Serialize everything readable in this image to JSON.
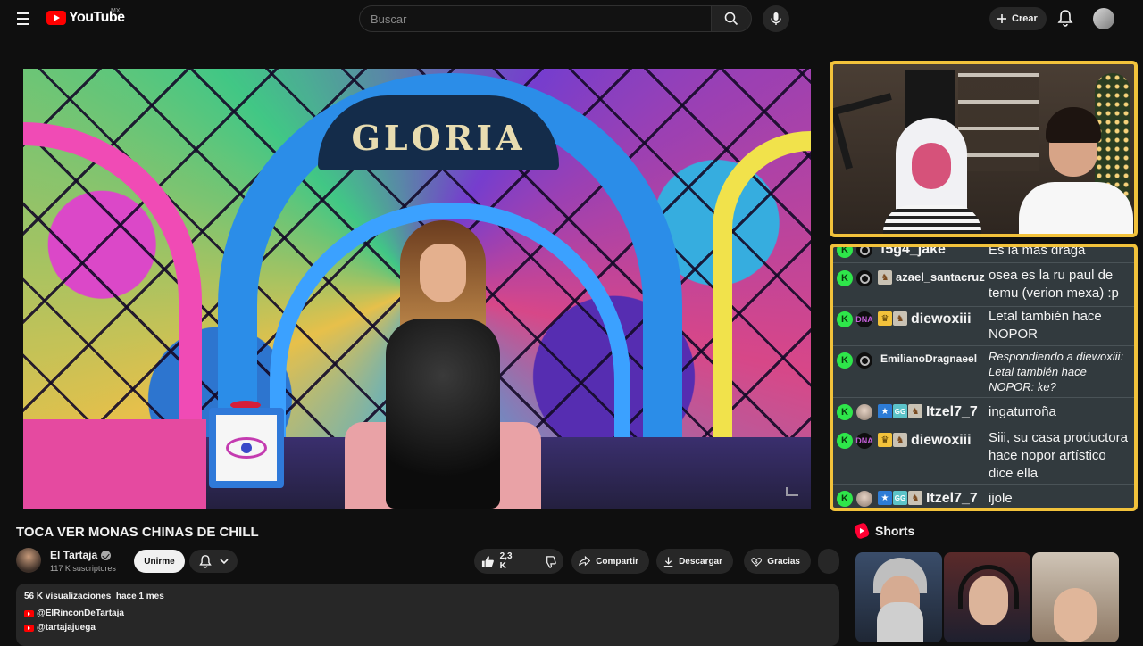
{
  "header": {
    "logo_text": "YouTube",
    "country_code": "MX",
    "search_placeholder": "Buscar",
    "create_label": "Crear"
  },
  "player": {
    "sign_text": "GLORIA"
  },
  "chat": {
    "messages": [
      {
        "user": "f5g4_jake",
        "text": "Es la más draga"
      },
      {
        "user": "azael_santacruz",
        "text": "osea es la ru paul de temu (verion mexa) :p"
      },
      {
        "user": "diewoxiii",
        "text": "Letal también hace NOPOR"
      },
      {
        "user": "EmilianoDragnaeel",
        "text": "Respondiendo a diewoxiii: Letal también hace NOPOR: ke?"
      },
      {
        "user": "Itzel7_7",
        "text": "ingaturroña"
      },
      {
        "user": "diewoxiii",
        "text": "Siii, su casa productora hace nopor artístico dice ella"
      },
      {
        "user": "Itzel7_7",
        "text": "ijole"
      }
    ]
  },
  "video": {
    "title": "TOCA VER MONAS CHINAS DE CHILL",
    "channel_name": "El Tartaja",
    "subscribers": "117 K suscriptores",
    "join_label": "Unirme",
    "likes": "2,3 K",
    "share_label": "Compartir",
    "download_label": "Descargar",
    "thanks_label": "Gracias",
    "views": "56 K visualizaciones",
    "date": "hace 1 mes",
    "links": [
      "@ElRinconDeTartaja",
      "@tartajajuega"
    ]
  },
  "shorts": {
    "heading": "Shorts"
  },
  "colors": {
    "accent_frame": "#f2c23b",
    "brand_red": "#ff0000",
    "chat_bg": "#323a3e"
  }
}
